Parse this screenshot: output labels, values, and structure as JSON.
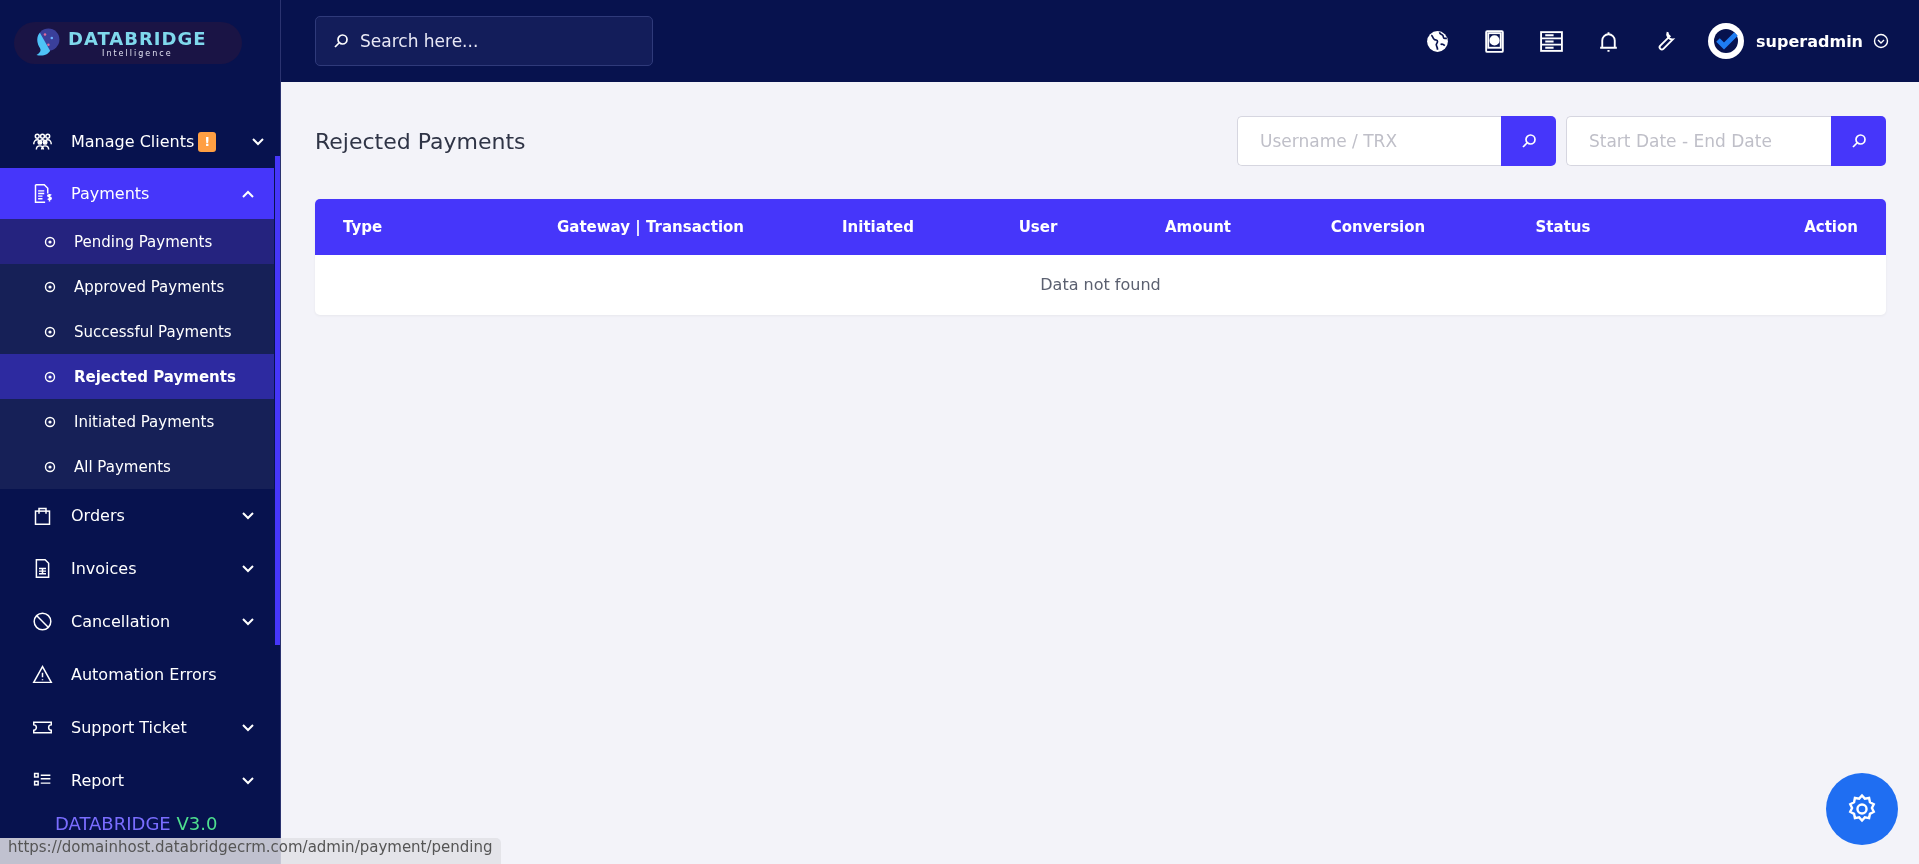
{
  "logo": {
    "name": "DATABRIDGE",
    "tagline": "Intelligence"
  },
  "sidebar": {
    "items": [
      {
        "kind": "group",
        "label": "Manage Clients",
        "badge": "!",
        "expanded": false,
        "selected": false
      },
      {
        "kind": "group",
        "label": "Payments",
        "expanded": true,
        "selected": true,
        "children": [
          {
            "label": "Pending Payments",
            "selected": false,
            "hovered": true
          },
          {
            "label": "Approved Payments",
            "selected": false,
            "hovered": false
          },
          {
            "label": "Successful Payments",
            "selected": false,
            "hovered": false
          },
          {
            "label": "Rejected Payments",
            "selected": true,
            "hovered": false
          },
          {
            "label": "Initiated Payments",
            "selected": false,
            "hovered": false
          },
          {
            "label": "All Payments",
            "selected": false,
            "hovered": false
          }
        ]
      },
      {
        "kind": "group",
        "label": "Orders",
        "expanded": false,
        "selected": false
      },
      {
        "kind": "group",
        "label": "Invoices",
        "expanded": false,
        "selected": false
      },
      {
        "kind": "group",
        "label": "Cancellation",
        "expanded": false,
        "selected": false
      },
      {
        "kind": "link",
        "label": "Automation Errors",
        "selected": false
      },
      {
        "kind": "group",
        "label": "Support Ticket",
        "expanded": false,
        "selected": false
      },
      {
        "kind": "group",
        "label": "Report",
        "expanded": false,
        "selected": false
      }
    ],
    "version": {
      "name": "DATABRIDGE",
      "number": "V3.0"
    }
  },
  "topbar": {
    "search": {
      "placeholder": "Search here..."
    },
    "user": {
      "name": "superadmin"
    }
  },
  "page": {
    "title": "Rejected Payments",
    "filters": [
      {
        "placeholder": "Username / TRX"
      },
      {
        "placeholder": "Start Date - End Date"
      }
    ],
    "table": {
      "columns": [
        "Type",
        "Gateway | Transaction",
        "Initiated",
        "User",
        "Amount",
        "Conversion",
        "Status",
        "Action"
      ],
      "empty_message": "Data not found"
    }
  },
  "status_bar": {
    "url": "https://domainhost.databridgecrm.com/admin/payment/pending"
  }
}
